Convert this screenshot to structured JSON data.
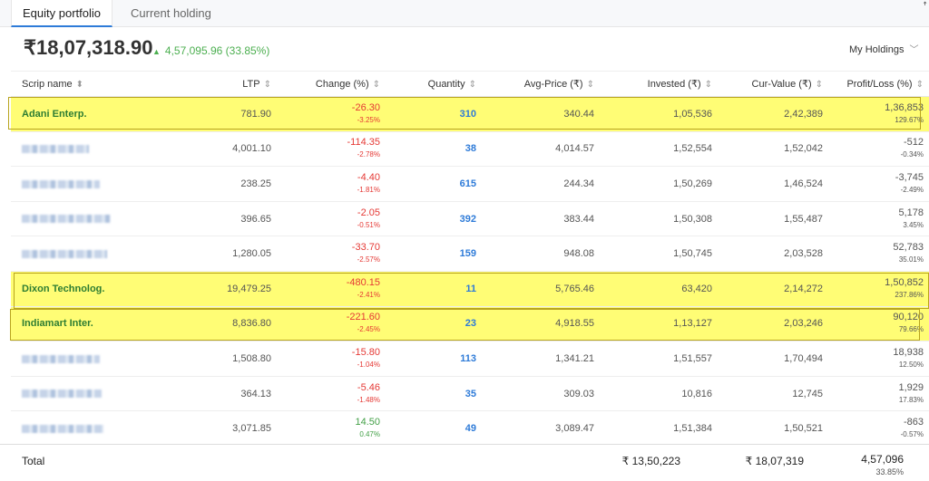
{
  "tabs": [
    {
      "label": "Equity portfolio",
      "active": true
    },
    {
      "label": "Current holding",
      "active": false
    }
  ],
  "summary": {
    "total_value": "₹18,07,318.90",
    "change": "4,57,095.96 (33.85%)",
    "change_color": "#4caf50",
    "view_select": "My Holdings"
  },
  "columns": [
    "Scrip name",
    "LTP",
    "Change (%)",
    "Quantity",
    "Avg-Price (₹)",
    "Invested (₹)",
    "Cur-Value (₹)",
    "Profit/Loss (%)"
  ],
  "rows": [
    {
      "name": "Adani Enterp.",
      "highlighted": true,
      "ltp": "781.90",
      "change": "-26.30",
      "change_pct": "-3.25%",
      "change_dir": "down",
      "qty": "310",
      "avg": "340.44",
      "invested": "1,05,536",
      "cur": "2,42,389",
      "pl": "1,36,853",
      "pl_pct": "129.67%"
    },
    {
      "name": "",
      "redacted": true,
      "ltp": "4,001.10",
      "change": "-114.35",
      "change_pct": "-2.78%",
      "change_dir": "down",
      "qty": "38",
      "avg": "4,014.57",
      "invested": "1,52,554",
      "cur": "1,52,042",
      "pl": "-512",
      "pl_pct": "-0.34%"
    },
    {
      "name": "",
      "redacted": true,
      "ltp": "238.25",
      "change": "-4.40",
      "change_pct": "-1.81%",
      "change_dir": "down",
      "qty": "615",
      "avg": "244.34",
      "invested": "1,50,269",
      "cur": "1,46,524",
      "pl": "-3,745",
      "pl_pct": "-2.49%"
    },
    {
      "name": "",
      "redacted": true,
      "ltp": "396.65",
      "change": "-2.05",
      "change_pct": "-0.51%",
      "change_dir": "down",
      "qty": "392",
      "avg": "383.44",
      "invested": "1,50,308",
      "cur": "1,55,487",
      "pl": "5,178",
      "pl_pct": "3.45%"
    },
    {
      "name": "",
      "redacted": true,
      "ltp": "1,280.05",
      "change": "-33.70",
      "change_pct": "-2.57%",
      "change_dir": "down",
      "qty": "159",
      "avg": "948.08",
      "invested": "1,50,745",
      "cur": "2,03,528",
      "pl": "52,783",
      "pl_pct": "35.01%"
    },
    {
      "name": "Dixon Technolog.",
      "highlighted": true,
      "ltp": "19,479.25",
      "change": "-480.15",
      "change_pct": "-2.41%",
      "change_dir": "down",
      "qty": "11",
      "avg": "5,765.46",
      "invested": "63,420",
      "cur": "2,14,272",
      "pl": "1,50,852",
      "pl_pct": "237.86%"
    },
    {
      "name": "Indiamart Inter.",
      "highlighted": true,
      "ltp": "8,836.80",
      "change": "-221.60",
      "change_pct": "-2.45%",
      "change_dir": "down",
      "qty": "23",
      "avg": "4,918.55",
      "invested": "1,13,127",
      "cur": "2,03,246",
      "pl": "90,120",
      "pl_pct": "79.66%"
    },
    {
      "name": "",
      "redacted": true,
      "ltp": "1,508.80",
      "change": "-15.80",
      "change_pct": "-1.04%",
      "change_dir": "down",
      "qty": "113",
      "avg": "1,341.21",
      "invested": "1,51,557",
      "cur": "1,70,494",
      "pl": "18,938",
      "pl_pct": "12.50%"
    },
    {
      "name": "",
      "redacted": true,
      "ltp": "364.13",
      "change": "-5.46",
      "change_pct": "-1.48%",
      "change_dir": "down",
      "qty": "35",
      "avg": "309.03",
      "invested": "10,816",
      "cur": "12,745",
      "pl": "1,929",
      "pl_pct": "17.83%"
    },
    {
      "name": "",
      "redacted": true,
      "ltp": "3,071.85",
      "change": "14.50",
      "change_pct": "0.47%",
      "change_dir": "up",
      "qty": "49",
      "avg": "3,089.47",
      "invested": "1,51,384",
      "cur": "1,50,521",
      "pl": "-863",
      "pl_pct": "-0.57%"
    }
  ],
  "totals": {
    "label": "Total",
    "invested": "₹ 13,50,223",
    "cur": "₹ 18,07,319",
    "pl": "4,57,096",
    "pl_pct": "33.85%"
  },
  "colors": {
    "highlight": "#fffd75",
    "negative": "#e53935",
    "positive": "#43a047",
    "quantity": "#2e7bd8",
    "scrip_name": "#2e7d32"
  }
}
